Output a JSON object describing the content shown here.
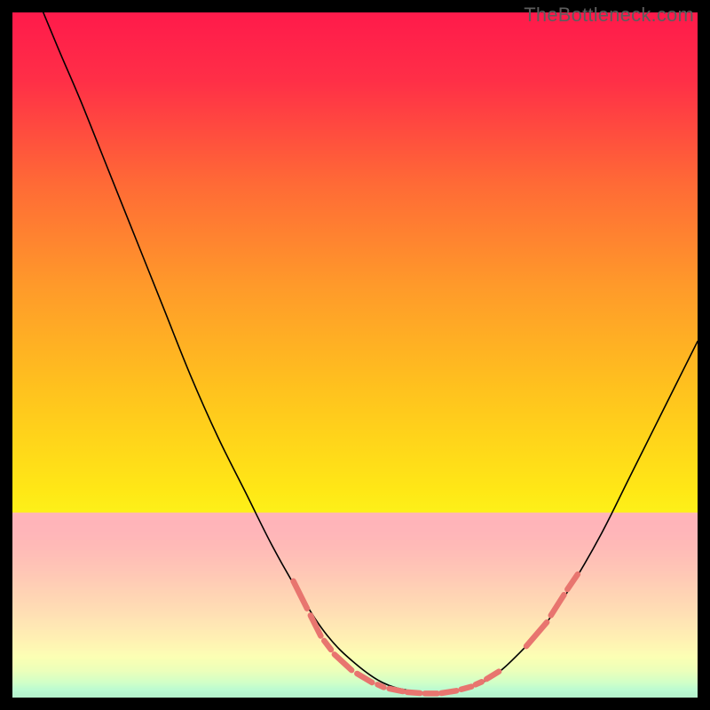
{
  "watermark": "TheBottleneck.com",
  "chart_data": {
    "type": "line",
    "title": "",
    "xlabel": "",
    "ylabel": "",
    "xlim": [
      0,
      100
    ],
    "ylim": [
      0,
      100
    ],
    "gradient_stops": [
      {
        "offset": 0.0,
        "color": "#ff1a4b"
      },
      {
        "offset": 0.1,
        "color": "#ff2f47"
      },
      {
        "offset": 0.25,
        "color": "#ff6a36"
      },
      {
        "offset": 0.4,
        "color": "#ff9a2a"
      },
      {
        "offset": 0.55,
        "color": "#ffc21e"
      },
      {
        "offset": 0.7,
        "color": "#ffe816"
      },
      {
        "offset": 0.78,
        "color": "#f9ff1e"
      },
      {
        "offset": 0.86,
        "color": "#d7ff55"
      },
      {
        "offset": 0.92,
        "color": "#9dff86"
      },
      {
        "offset": 0.96,
        "color": "#58f7a0"
      },
      {
        "offset": 1.0,
        "color": "#17e28f"
      }
    ],
    "pale_band": {
      "y_top": 73,
      "y_bottom": 100
    },
    "series": [
      {
        "name": "left-curve",
        "stroke": "#000000",
        "width": 1.6,
        "points": [
          {
            "x": 4.5,
            "y": 100
          },
          {
            "x": 7,
            "y": 94
          },
          {
            "x": 10,
            "y": 87
          },
          {
            "x": 14,
            "y": 77
          },
          {
            "x": 18,
            "y": 67
          },
          {
            "x": 22,
            "y": 57
          },
          {
            "x": 26,
            "y": 47
          },
          {
            "x": 30,
            "y": 38
          },
          {
            "x": 34,
            "y": 30
          },
          {
            "x": 38,
            "y": 22
          },
          {
            "x": 42,
            "y": 15
          },
          {
            "x": 46,
            "y": 9
          },
          {
            "x": 50,
            "y": 5
          },
          {
            "x": 54,
            "y": 2.2
          },
          {
            "x": 58,
            "y": 1.0
          },
          {
            "x": 62,
            "y": 0.6
          }
        ]
      },
      {
        "name": "right-curve",
        "stroke": "#000000",
        "width": 1.6,
        "points": [
          {
            "x": 62,
            "y": 0.6
          },
          {
            "x": 66,
            "y": 1.3
          },
          {
            "x": 70,
            "y": 3.0
          },
          {
            "x": 74,
            "y": 6.5
          },
          {
            "x": 78,
            "y": 11
          },
          {
            "x": 82,
            "y": 17
          },
          {
            "x": 86,
            "y": 24
          },
          {
            "x": 90,
            "y": 32
          },
          {
            "x": 94,
            "y": 40
          },
          {
            "x": 98,
            "y": 48
          },
          {
            "x": 100,
            "y": 52
          }
        ]
      }
    ],
    "highlight_segments": {
      "stroke": "#e8756f",
      "width": 6.5,
      "segments": [
        [
          {
            "x": 41,
            "y": 17
          },
          {
            "x": 43,
            "y": 13
          }
        ],
        [
          {
            "x": 43.5,
            "y": 12
          },
          {
            "x": 45,
            "y": 9
          }
        ],
        [
          {
            "x": 45.5,
            "y": 8.3
          },
          {
            "x": 46.5,
            "y": 7
          }
        ],
        [
          {
            "x": 47,
            "y": 6.3
          },
          {
            "x": 49.5,
            "y": 4
          }
        ],
        [
          {
            "x": 50.3,
            "y": 3.5
          },
          {
            "x": 52.5,
            "y": 2.2
          }
        ],
        [
          {
            "x": 53.3,
            "y": 1.9
          },
          {
            "x": 54.2,
            "y": 1.5
          }
        ],
        [
          {
            "x": 55,
            "y": 1.3
          },
          {
            "x": 57,
            "y": 0.9
          }
        ],
        [
          {
            "x": 57.6,
            "y": 0.8
          },
          {
            "x": 59.5,
            "y": 0.65
          }
        ],
        [
          {
            "x": 60.2,
            "y": 0.6
          },
          {
            "x": 62,
            "y": 0.6
          }
        ],
        [
          {
            "x": 62.6,
            "y": 0.65
          },
          {
            "x": 64.8,
            "y": 1.0
          }
        ],
        [
          {
            "x": 65.5,
            "y": 1.2
          },
          {
            "x": 67,
            "y": 1.6
          }
        ],
        [
          {
            "x": 67.6,
            "y": 1.9
          },
          {
            "x": 68.5,
            "y": 2.3
          }
        ],
        [
          {
            "x": 69.2,
            "y": 2.7
          },
          {
            "x": 71,
            "y": 3.8
          }
        ],
        [
          {
            "x": 75,
            "y": 7.5
          },
          {
            "x": 78,
            "y": 11
          }
        ],
        [
          {
            "x": 78.6,
            "y": 12
          },
          {
            "x": 80.5,
            "y": 15
          }
        ],
        [
          {
            "x": 81,
            "y": 15.8
          },
          {
            "x": 82.5,
            "y": 18
          }
        ]
      ]
    }
  }
}
